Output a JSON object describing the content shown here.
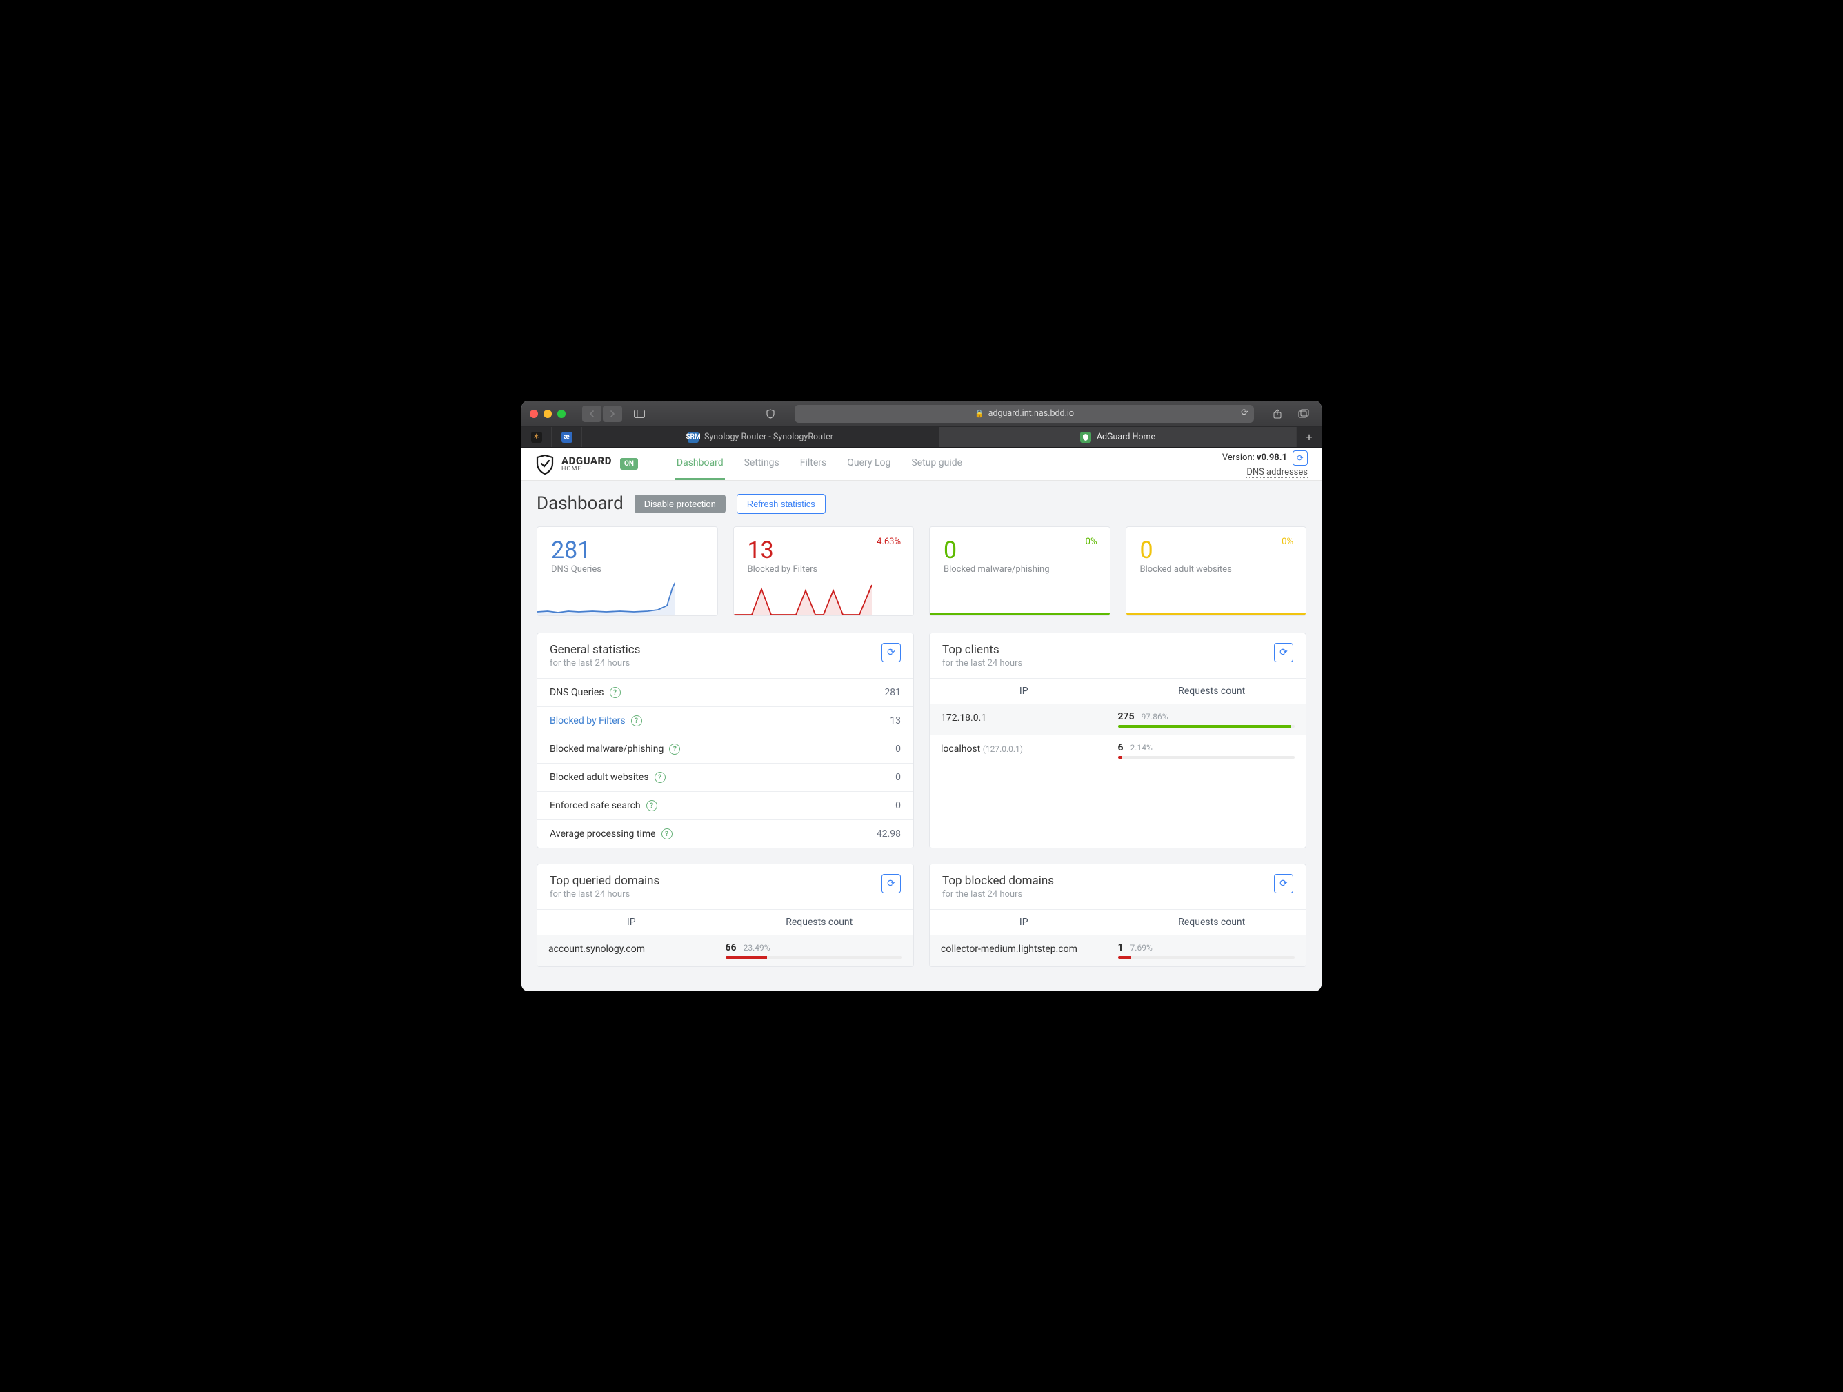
{
  "browser": {
    "url": "adguard.int.nas.bdd.io",
    "tabs": [
      {
        "label": "",
        "icon": "fav1"
      },
      {
        "label": "",
        "icon": "fav2"
      },
      {
        "label": "Synology Router - SynologyRouter",
        "icon": "fav3"
      },
      {
        "label": "AdGuard Home",
        "icon": "fav4"
      }
    ]
  },
  "header": {
    "logo_line1": "ADGUARD",
    "logo_line2": "HOME",
    "status_badge": "ON",
    "nav": {
      "dashboard": "Dashboard",
      "settings": "Settings",
      "filters": "Filters",
      "querylog": "Query Log",
      "setup": "Setup guide"
    },
    "version_label": "Version: ",
    "version": "v0.98.1",
    "dns_addresses": "DNS addresses"
  },
  "page": {
    "title": "Dashboard",
    "disable_btn": "Disable protection",
    "refresh_btn": "Refresh statistics"
  },
  "cards": {
    "queries": {
      "value": "281",
      "label": "DNS Queries"
    },
    "blocked": {
      "value": "13",
      "label": "Blocked by Filters",
      "pct": "4.63%"
    },
    "malware": {
      "value": "0",
      "label": "Blocked malware/phishing",
      "pct": "0%"
    },
    "adult": {
      "value": "0",
      "label": "Blocked adult websites",
      "pct": "0%"
    }
  },
  "general_stats": {
    "title": "General statistics",
    "subtitle": "for the last 24 hours",
    "rows": {
      "dns_queries": {
        "k": "DNS Queries",
        "v": "281"
      },
      "blocked_filters": {
        "k": "Blocked by Filters",
        "v": "13"
      },
      "malware": {
        "k": "Blocked malware/phishing",
        "v": "0"
      },
      "adult": {
        "k": "Blocked adult websites",
        "v": "0"
      },
      "safesearch": {
        "k": "Enforced safe search",
        "v": "0"
      },
      "avg_time": {
        "k": "Average processing time",
        "v": "42.98"
      }
    }
  },
  "top_clients": {
    "title": "Top clients",
    "subtitle": "for the last 24 hours",
    "col_ip": "IP",
    "col_count": "Requests count",
    "rows": [
      {
        "ip": "172.18.0.1",
        "sub": "",
        "count": "275",
        "pct": "97.86%",
        "bar_pct": 97.86,
        "bar": "bf-green"
      },
      {
        "ip": "localhost",
        "sub": "(127.0.0.1)",
        "count": "6",
        "pct": "2.14%",
        "bar_pct": 2.14,
        "bar": "bf-red"
      }
    ]
  },
  "top_queried": {
    "title": "Top queried domains",
    "subtitle": "for the last 24 hours",
    "col_ip": "IP",
    "col_count": "Requests count",
    "rows": [
      {
        "ip": "account.synology.com",
        "count": "66",
        "pct": "23.49%",
        "bar_pct": 23.49,
        "bar": "bf-red"
      }
    ]
  },
  "top_blocked": {
    "title": "Top blocked domains",
    "subtitle": "for the last 24 hours",
    "col_ip": "IP",
    "col_count": "Requests count",
    "rows": [
      {
        "ip": "collector-medium.lightstep.com",
        "count": "1",
        "pct": "7.69%",
        "bar_pct": 7.69,
        "bar": "bf-red"
      }
    ]
  }
}
